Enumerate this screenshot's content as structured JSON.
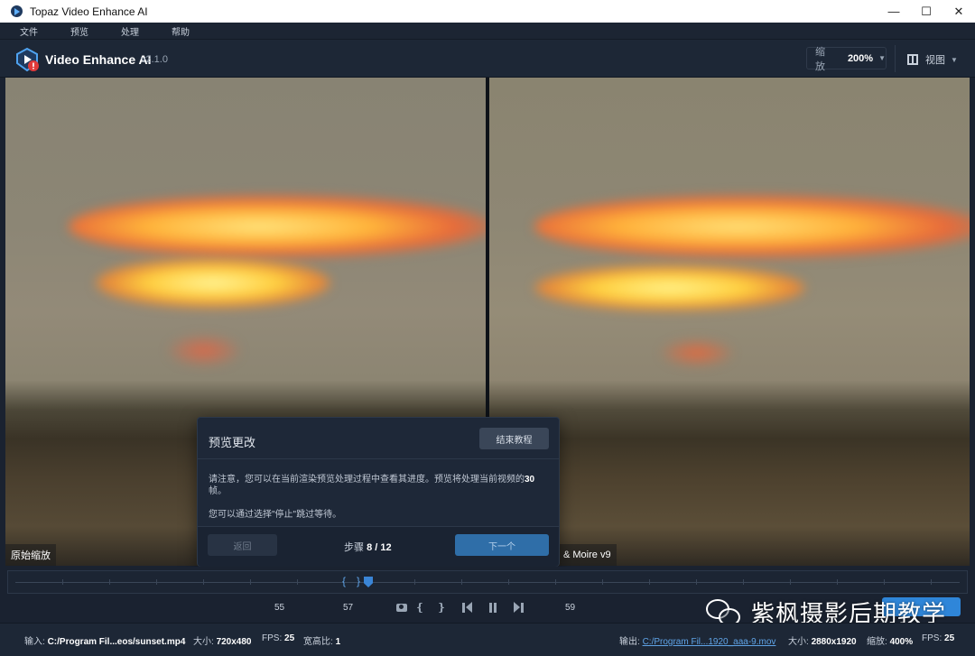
{
  "window": {
    "title": "Topaz Video Enhance AI",
    "minimize_glyph": "—",
    "maximize_glyph": "☐",
    "close_glyph": "✕"
  },
  "menu": [
    "文件",
    "预览",
    "处理",
    "帮助"
  ],
  "header": {
    "app_name": "Video Enhance AI",
    "version": "v2.1.0",
    "zoom_label": "缩放",
    "zoom_value": "200%",
    "view_label": "视图",
    "accent_color": "#2f86d9"
  },
  "preview": {
    "left_label": "原始缩放",
    "right_label": "& Moire v9"
  },
  "dialog": {
    "title": "预览更改",
    "end_button": "结束教程",
    "body_part1": "请注意，您可以在当前渲染预览处理过程中查看其进度。预览将处理当前视频的",
    "body_bold": "30",
    "body_part2": "帧。",
    "body_line2": "您可以通过选择\"停止\"跳过等待。",
    "back_button": "返回",
    "step_label": "步骤",
    "step_value": "8 / 12",
    "next_button": "下一个"
  },
  "timeline": {
    "frame_start": "55",
    "frame_current": "57",
    "frame_end": "59",
    "bracket_open": "{",
    "bracket_close": "}"
  },
  "watermark": {
    "text": "紫枫摄影后期教学"
  },
  "status": {
    "input_label": "输入:",
    "input_path": "C:/Program Fil...eos/sunset.mp4",
    "in_size_label": "大小:",
    "in_size": "720x480",
    "in_fps_label": "FPS:",
    "in_fps": "25",
    "aspect_label": "宽高比:",
    "aspect": "1",
    "output_label": "输出:",
    "output_path": "C:/Program Fil...1920_aaa-9.mov",
    "out_size_label": "大小:",
    "out_size": "2880x1920",
    "scale_label": "缩放:",
    "scale": "400%",
    "out_fps_label": "FPS:",
    "out_fps": "25"
  }
}
